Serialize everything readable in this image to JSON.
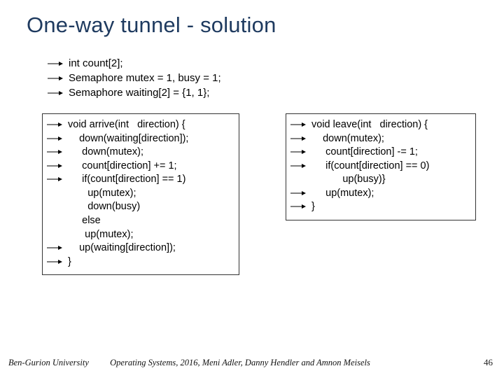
{
  "title": "One-way tunnel - solution",
  "decl": {
    "l1": "int count[2];",
    "l2": "Semaphore mutex = 1, busy = 1;",
    "l3": "Semaphore waiting[2] = {1, 1};"
  },
  "left": {
    "l1": "void arrive(int   direction) {",
    "l2": "    down(waiting[direction]);",
    "l3": "     down(mutex);",
    "l4": "     count[direction] += 1;",
    "l5": "     if(count[direction] == 1)",
    "l6": "       up(mutex);",
    "l7": "       down(busy)",
    "l8": "     else",
    "l9": "      up(mutex);",
    "l10": "    up(waiting[direction]);",
    "l11": "}"
  },
  "right": {
    "l1": "void leave(int   direction) {",
    "l2": "    down(mutex);",
    "l3": "     count[direction] -= 1;",
    "l4": "     if(count[direction] == 0)",
    "l5": "           up(busy)}",
    "l6": "     up(mutex);",
    "l7": "}"
  },
  "footer": {
    "univ": "Ben-Gurion University",
    "credit": "Operating Systems, 2016, Meni Adler, Danny Hendler and Amnon Meisels"
  },
  "page": "46"
}
